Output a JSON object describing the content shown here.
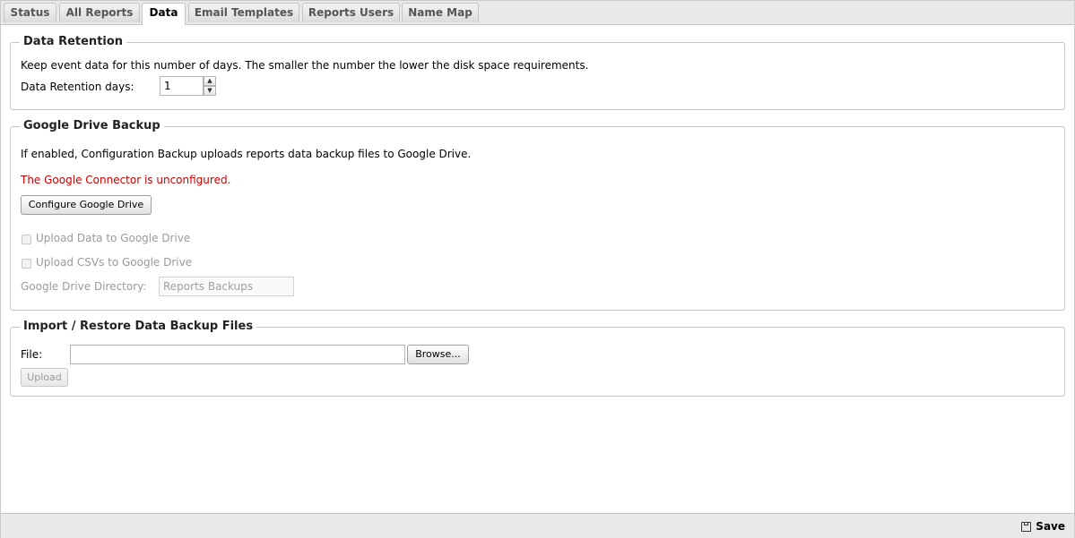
{
  "tabs": [
    {
      "label": "Status"
    },
    {
      "label": "All Reports"
    },
    {
      "label": "Data"
    },
    {
      "label": "Email Templates"
    },
    {
      "label": "Reports Users"
    },
    {
      "label": "Name Map"
    }
  ],
  "active_tab": "Data",
  "retention": {
    "legend": "Data Retention",
    "description": "Keep event data for this number of days. The smaller the number the lower the disk space requirements.",
    "days_label": "Data Retention days:",
    "days_value": "1"
  },
  "gdrive": {
    "legend": "Google Drive Backup",
    "description": "If enabled, Configuration Backup uploads reports data backup files to Google Drive.",
    "warning": "The Google Connector is unconfigured.",
    "configure_button": "Configure Google Drive",
    "upload_data_label": "Upload Data to Google Drive",
    "upload_csvs_label": "Upload CSVs to Google Drive",
    "directory_label": "Google Drive Directory:",
    "directory_value": "Reports Backups"
  },
  "import": {
    "legend": "Import / Restore Data Backup Files",
    "file_label": "File:",
    "file_value": "",
    "browse_button": "Browse...",
    "upload_button": "Upload"
  },
  "footer": {
    "save_label": "Save"
  }
}
